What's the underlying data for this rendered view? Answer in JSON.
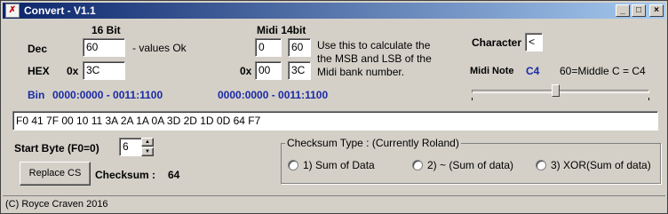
{
  "window": {
    "title": "Convert - V1.1",
    "app_icon": "tool-icon"
  },
  "titlebar_buttons": {
    "minimize": "_",
    "maximize": "□",
    "close": "×"
  },
  "sixteen_bit": {
    "header": "16 Bit",
    "dec_label": "Dec",
    "dec_value": "60",
    "dec_status": "- values Ok",
    "hex_label": "HEX",
    "hex_prefix": "0x",
    "hex_value": "3C",
    "bin_label": "Bin",
    "bin_value": "0000:0000 - 0011:1100"
  },
  "midi_14bit": {
    "header": "Midi 14bit",
    "dec_msb": "0",
    "dec_lsb": "60",
    "hex_prefix": "0x",
    "hex_msb": "00",
    "hex_lsb": "3C",
    "bin_value": "0000:0000 - 0011:1100",
    "help_lines": [
      "Use this to calculate the",
      "the MSB and LSB of the",
      "Midi bank number."
    ]
  },
  "character": {
    "label": "Character",
    "value": "<"
  },
  "midi_note": {
    "label": "Midi Note",
    "value": "C4",
    "hint": "60=Middle C = C4",
    "slider_level_pct": 47
  },
  "sysex_field": {
    "value": "F0 41 7F 00 10 11 3A 2A 1A 0A 3D 2D 1D 0D 64 F7"
  },
  "start_byte": {
    "label": "Start Byte (F0=0)",
    "value": "6"
  },
  "replace_cs_button": "Replace CS",
  "checksum": {
    "label": "Checksum :",
    "value": "64"
  },
  "checksum_type": {
    "title": "Checksum Type : (Currently Roland)",
    "options": [
      {
        "label": "1) Sum of Data",
        "selected": false
      },
      {
        "label": "2) ~ (Sum of data)",
        "selected": true
      },
      {
        "label": "3) XOR(Sum of data)",
        "selected": false
      }
    ]
  },
  "status_bar": {
    "text": "(C) Royce Craven 2016"
  }
}
